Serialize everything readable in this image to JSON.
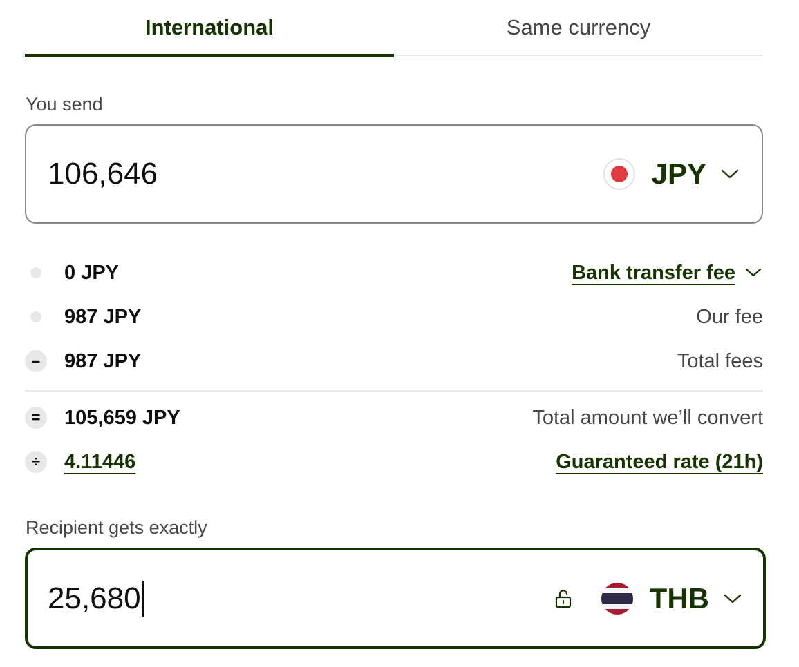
{
  "tabs": [
    {
      "label": "International",
      "active": true
    },
    {
      "label": "Same currency",
      "active": false
    }
  ],
  "send": {
    "label": "You send",
    "amount": "106,646",
    "currency": "JPY",
    "flag_icon": "japan-flag-icon"
  },
  "breakdown": [
    {
      "bullet": "",
      "value": "0 JPY",
      "label": "Bank transfer fee"
    },
    {
      "bullet": "",
      "value": "987 JPY",
      "label": "Our fee"
    },
    {
      "bullet": "–",
      "value": "987 JPY",
      "label": "Total fees"
    },
    {
      "bullet": "=",
      "value": "105,659 JPY",
      "label": "Total amount we’ll convert"
    },
    {
      "bullet": "÷",
      "value": "4.11446",
      "label": "Guaranteed rate (21h)"
    }
  ],
  "receive": {
    "label": "Recipient gets exactly",
    "amount": "25,680",
    "currency": "THB",
    "flag_icon": "thailand-flag-icon",
    "lock_icon": "unlock-icon"
  },
  "colors": {
    "accent": "#163300",
    "text": "#0e0f0c",
    "muted": "#454745",
    "border": "#868685",
    "bullet_bg": "#e8e9e6"
  }
}
